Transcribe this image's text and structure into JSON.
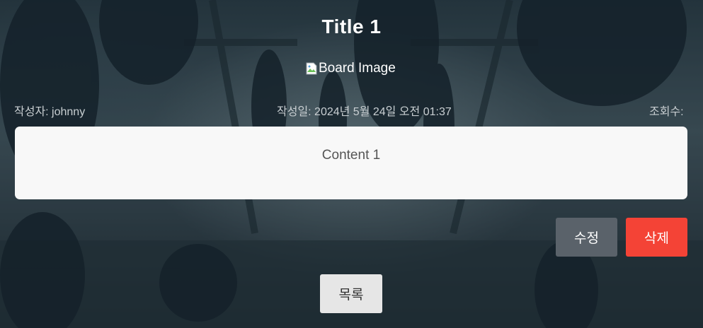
{
  "post": {
    "title": "Title 1",
    "image_alt": "Board Image",
    "author": "작성자: johnny",
    "date": "작성일: 2024년 5월 24일 오전 01:37",
    "views": "조회수:",
    "content": "Content 1"
  },
  "actions": {
    "edit_label": "수정",
    "delete_label": "삭제",
    "list_label": "목록"
  },
  "colors": {
    "edit_button": "#5a626a",
    "delete_button": "#f44336",
    "list_button": "#e6e6e6",
    "content_box": "#f8f8f8"
  },
  "icons": {
    "broken_image": "broken-image-icon"
  }
}
